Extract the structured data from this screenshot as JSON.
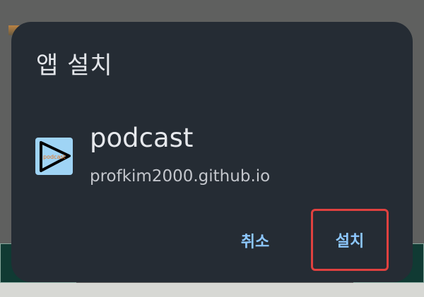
{
  "dialog": {
    "title": "앱 설치",
    "app": {
      "name": "podcast",
      "host": "profkim2000.github.io",
      "icon_text": "podcast",
      "icon": "play-triangle-icon"
    },
    "actions": {
      "cancel_label": "취소",
      "install_label": "설치"
    }
  },
  "colors": {
    "dialog_bg": "#252c34",
    "accent": "#8dc8ff",
    "highlight": "#e0413f",
    "icon_bg": "#9fd4f5"
  }
}
